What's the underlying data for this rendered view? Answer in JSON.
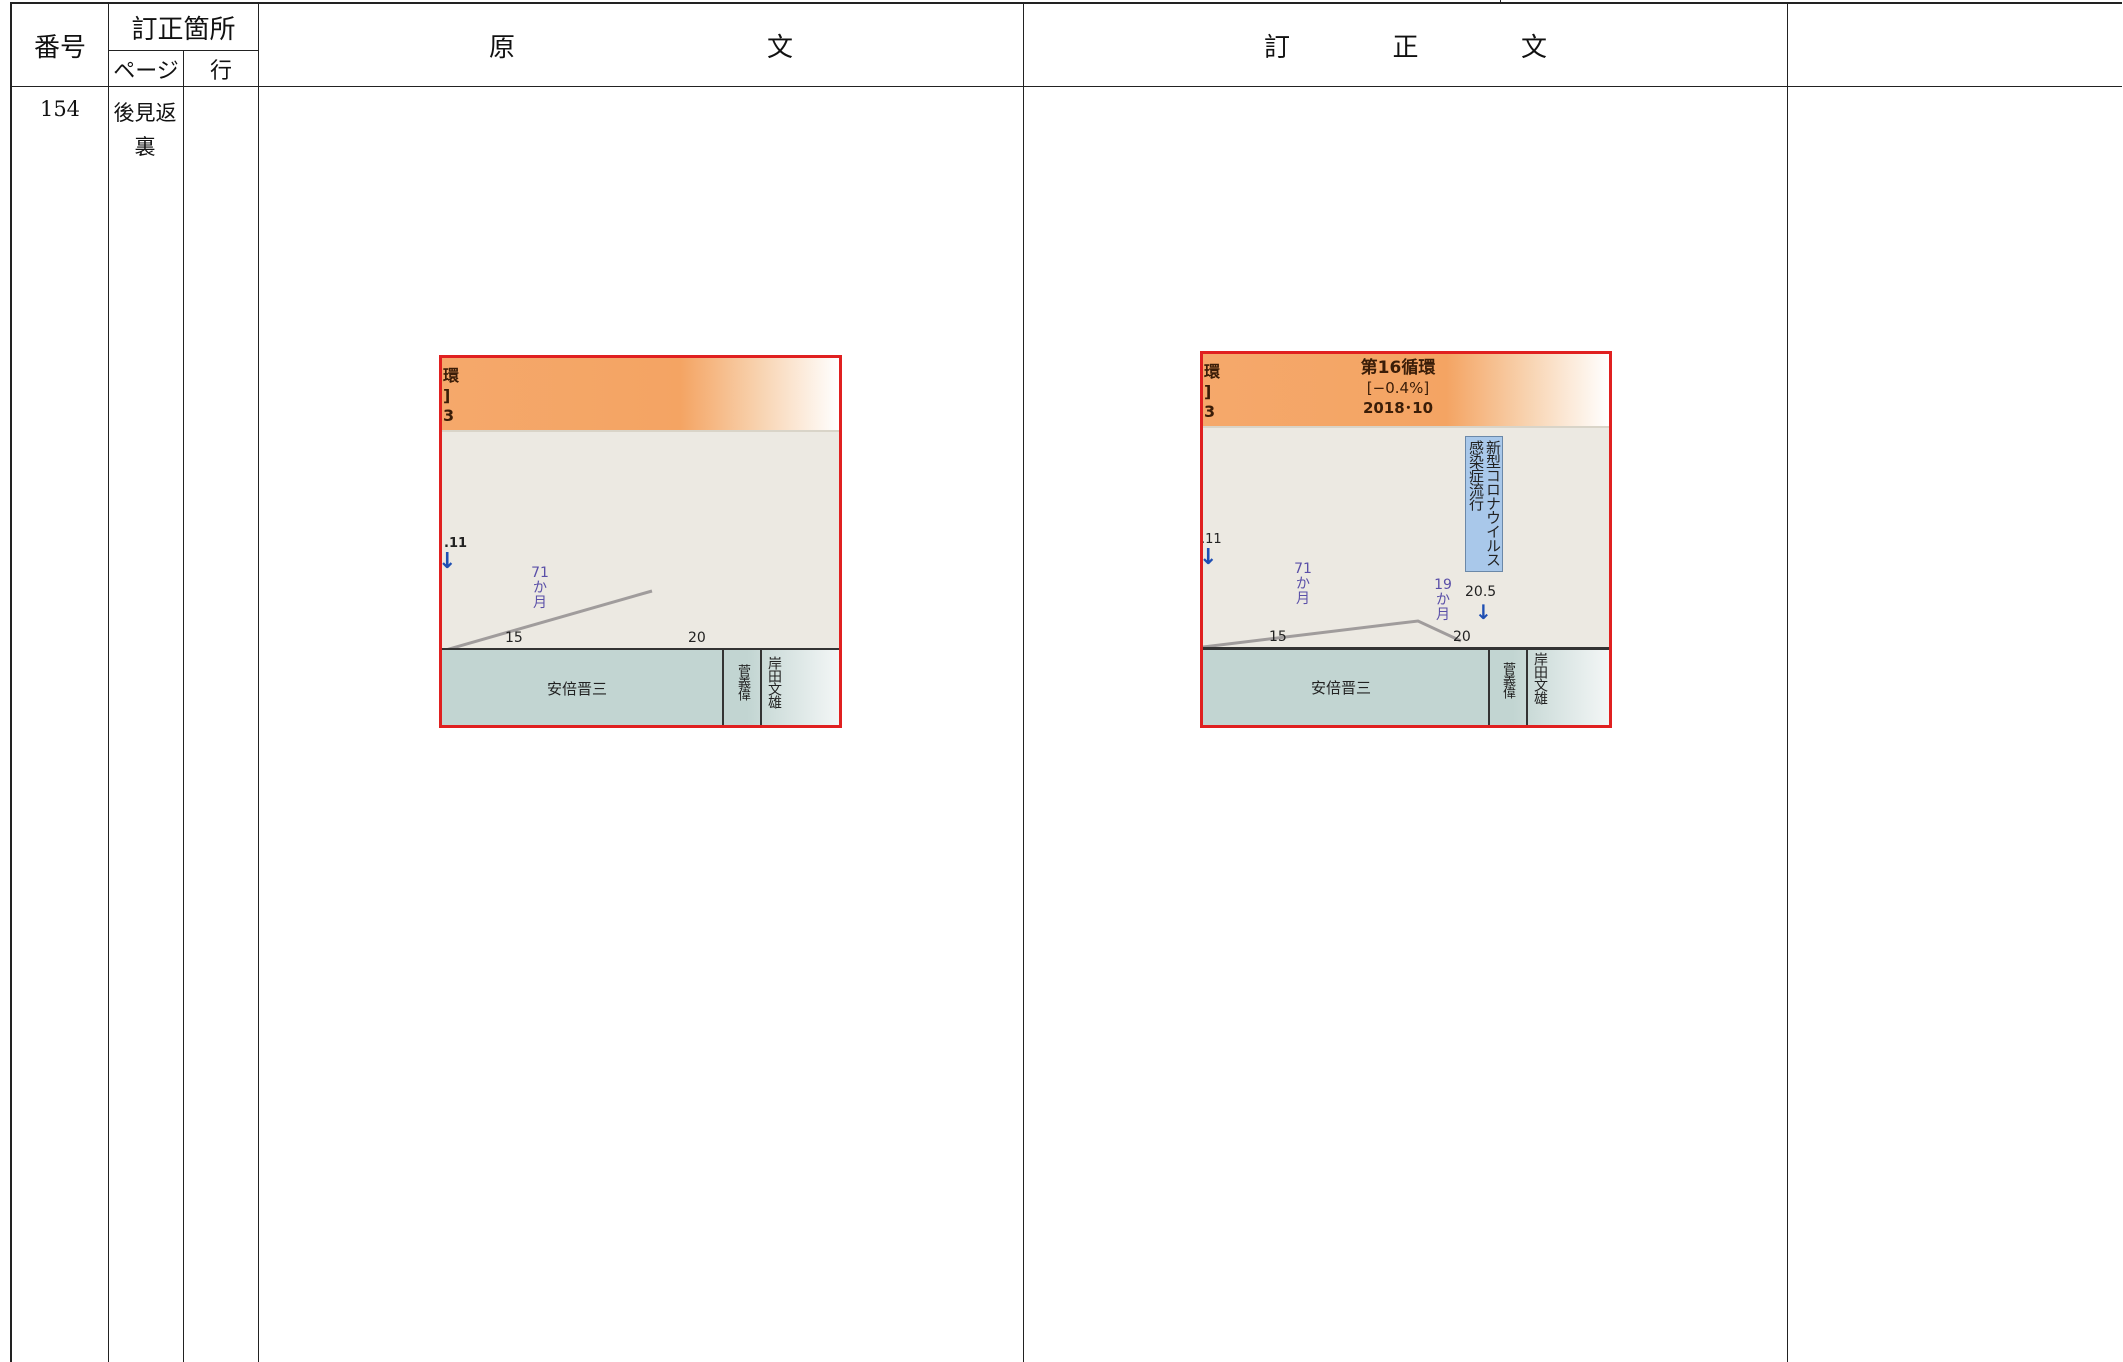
{
  "table": {
    "col_number": "番号",
    "col_location": "訂正箇所",
    "col_page": "ページ",
    "col_line": "行",
    "col_original": [
      "原",
      "文"
    ],
    "col_corrected": [
      "訂",
      "正",
      "文"
    ],
    "row": {
      "number": "154",
      "page_text": "後見返裏",
      "line": ""
    }
  },
  "figure_original": {
    "band_lines": [
      "環",
      "]",
      "3"
    ],
    "arrow_label": ".11",
    "months_value": "71",
    "months_unit": [
      "か",
      "月"
    ],
    "ticks": [
      "15",
      "20"
    ],
    "pms": [
      "安倍晋三",
      "菅義偉",
      "岸田文雄"
    ]
  },
  "figure_corrected": {
    "band_left_lines": [
      "環",
      "]",
      "3"
    ],
    "cycle_title": "第16循環",
    "cycle_pct": "[−0.4%]",
    "cycle_date": "2018･10",
    "arrow_label": ".11",
    "months_value": "71",
    "months_unit": [
      "か",
      "月"
    ],
    "months2_value": "19",
    "months2_unit": [
      "か",
      "月"
    ],
    "covid_label": "新型コロナウイルス感染症流行",
    "covid_date": "20.5",
    "ticks": [
      "15",
      "20"
    ],
    "pms": [
      "安倍晋三",
      "菅義偉",
      "岸田文雄"
    ]
  },
  "colors": {
    "frame": "#e02020",
    "band_orange": "#f4a463",
    "pm_band": "#c2d5d2",
    "months_purple": "#5a4fa8",
    "arrow_blue": "#1f4fb3",
    "callout_blue": "#a9c8ea"
  }
}
